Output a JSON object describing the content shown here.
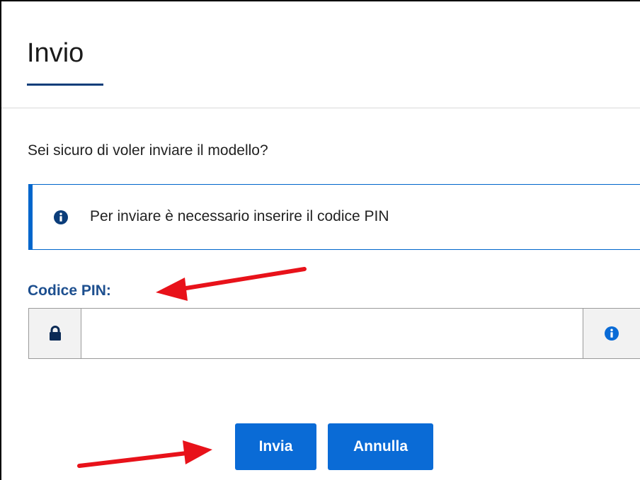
{
  "dialog": {
    "title": "Invio",
    "question": "Sei sicuro di voler inviare il modello?",
    "info_message": "Per inviare è necessario inserire il codice PIN",
    "pin_label": "Codice PIN:",
    "pin_value": "",
    "buttons": {
      "submit_label": "Invia",
      "cancel_label": "Annulla"
    }
  },
  "icons": {
    "info": "info-circle-icon",
    "lock": "lock-icon",
    "pin_info": "info-circle-icon",
    "annotation": "red-arrow-icon"
  },
  "colors": {
    "accent": "#0066cc",
    "button": "#0a6bd6",
    "label": "#1d4f8f",
    "title_underline": "#0b3d7a",
    "annotation_arrow": "#e8121a"
  }
}
